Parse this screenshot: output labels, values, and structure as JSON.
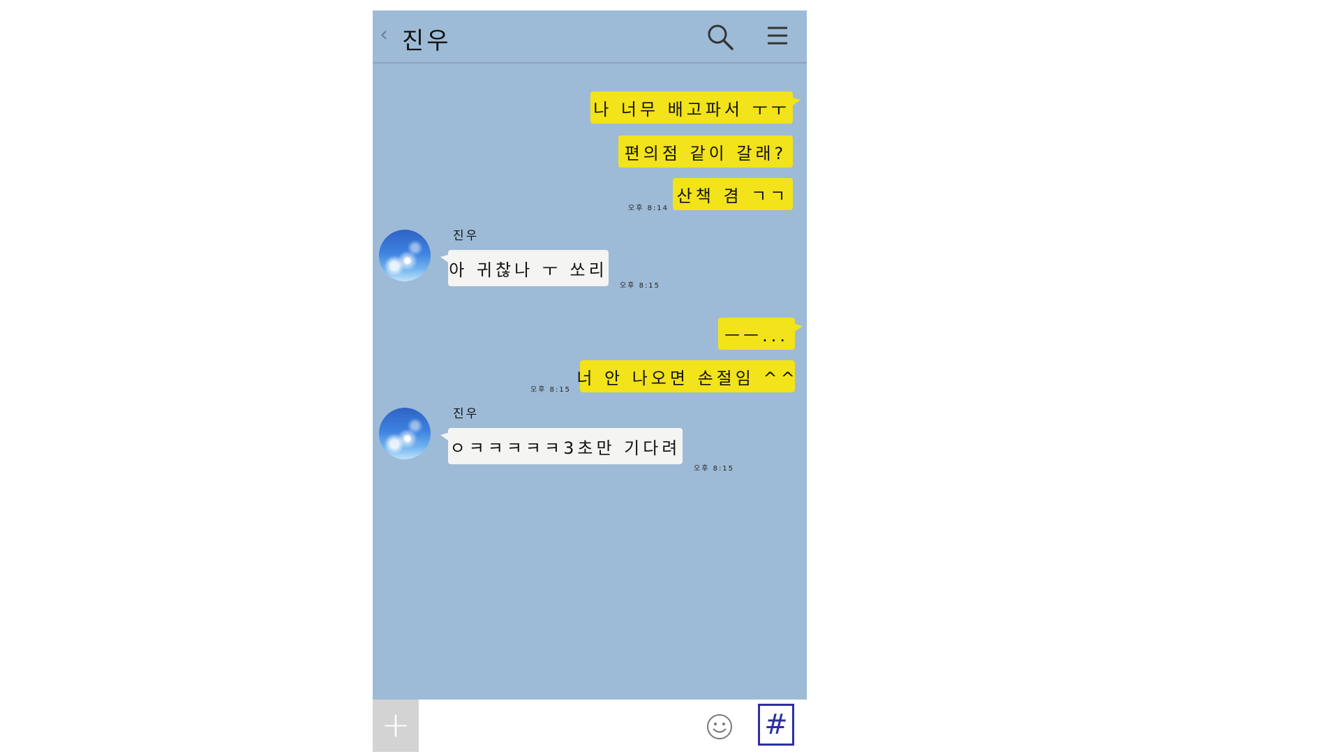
{
  "header": {
    "back_icon": "chevron-left-icon",
    "title": "진우",
    "search_icon": "search-icon",
    "menu_icon": "menu-icon"
  },
  "messages": [
    {
      "side": "me",
      "text": "나 너무 배고파서 ㅜㅜ"
    },
    {
      "side": "me",
      "text": "편의점 같이 갈래?"
    },
    {
      "side": "me",
      "text": "산책 겸 ㄱㄱ",
      "time": "오후 8:14"
    },
    {
      "side": "them",
      "sender": "진우",
      "text": "아 귀찮나 ㅜ 쏘리",
      "time": "오후 8:15"
    },
    {
      "side": "me",
      "text": "ㅡㅡ..."
    },
    {
      "side": "me",
      "text": "너 안 나오면 손절임 ^^",
      "time": "오후 8:15"
    },
    {
      "side": "them",
      "sender": "진우",
      "text": "ㅇㅋㅋㅋㅋㅋ3초만 기다려",
      "time": "오후 8:15"
    }
  ],
  "input_bar": {
    "plus_label": "+",
    "emoji_icon": "smiley-icon",
    "hash_label": "#"
  },
  "colors": {
    "chat_background": "#9dbbd6",
    "my_bubble": "#f2e31a",
    "their_bubble": "#f4f4f2",
    "hash_border": "#2b2fa3"
  }
}
